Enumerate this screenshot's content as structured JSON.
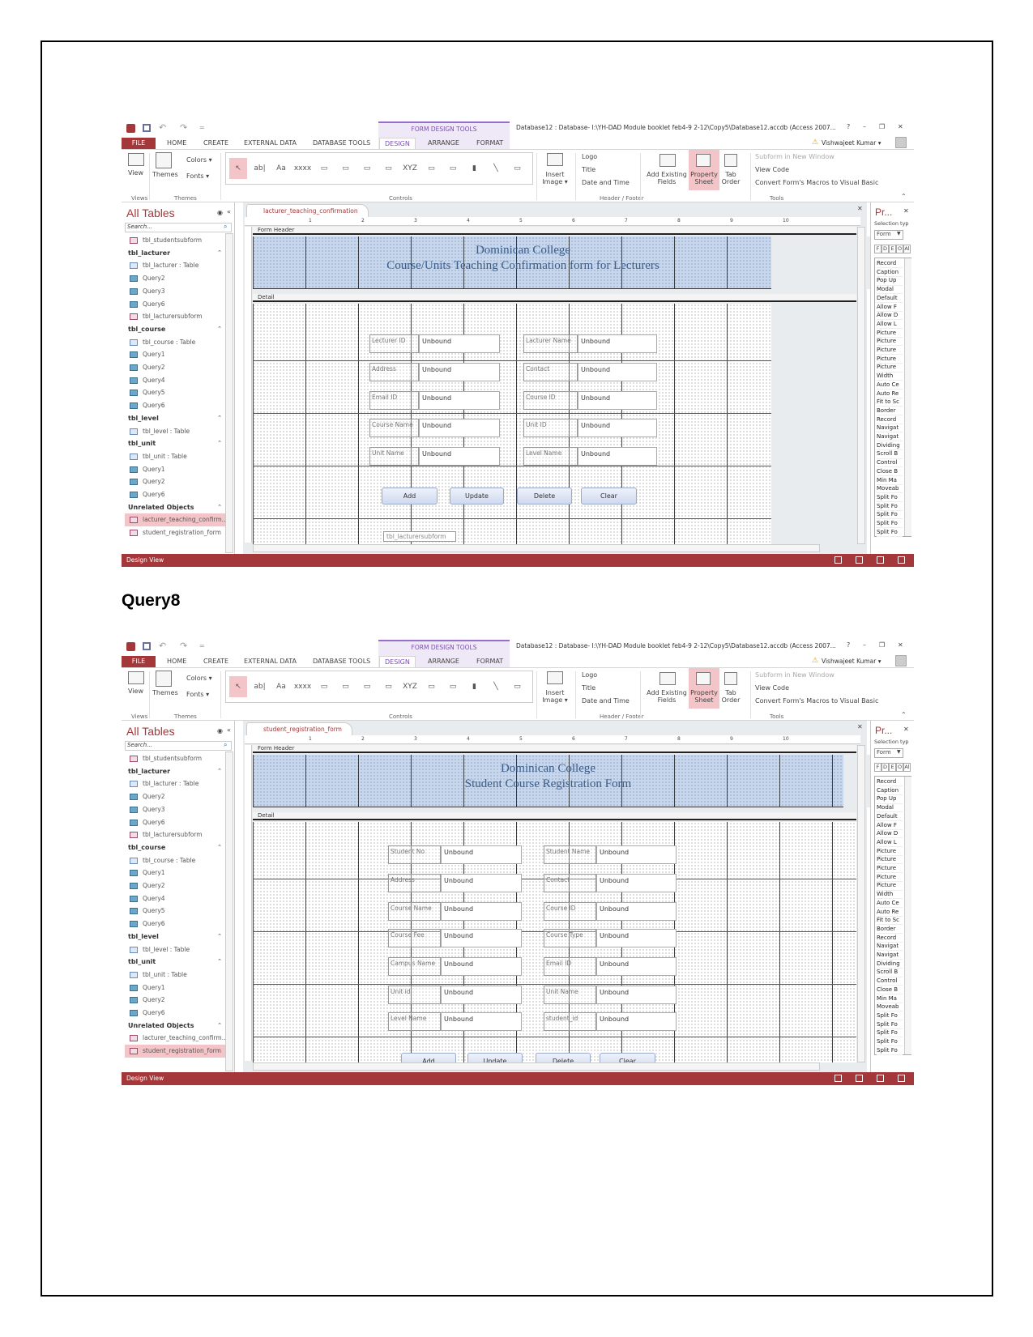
{
  "document": {
    "heading": "Query8"
  },
  "qat": {
    "app_icon": "access-logo-icon",
    "save": "save-icon",
    "undo": "undo-icon",
    "redo": "redo-icon",
    "customize": "="
  },
  "window": {
    "context_tab_group": "FORM DESIGN TOOLS",
    "title": "Database12 : Database- I:\\YH-DAD Module booklet feb4-9 2-12\\Copy5\\Database12.accdb (Access 2007...",
    "help": "?",
    "minimize": "–",
    "restore": "❐",
    "close": "✕",
    "user": "Vishwajeet Kumar ▾"
  },
  "ribbon_tabs": [
    "FILE",
    "HOME",
    "CREATE",
    "EXTERNAL DATA",
    "DATABASE TOOLS",
    "DESIGN",
    "ARRANGE",
    "FORMAT"
  ],
  "ribbon_selected_tab": "DESIGN",
  "ribbon": {
    "view": "View",
    "themes": "Themes",
    "colors": "Colors ▾",
    "fonts": "Fonts ▾",
    "insert_image": "Insert Image ▾",
    "logo": "Logo",
    "title": "Title",
    "date_time": "Date and Time",
    "add_existing_fields": "Add Existing Fields",
    "property_sheet": "Property Sheet",
    "tab_order": "Tab Order",
    "subform_new_window": "Subform in New Window",
    "view_code": "View Code",
    "convert_macros": "Convert Form's Macros to Visual Basic",
    "groups": [
      "Views",
      "Themes",
      "Controls",
      "Header / Footer",
      "Tools"
    ],
    "controls": [
      "select",
      "ab|",
      "Aa",
      "xxxx",
      "tab",
      "hyperlink",
      "web",
      "nav",
      "XYZ",
      "page-break",
      "combo",
      "chart",
      "line",
      "toggle"
    ]
  },
  "nav": {
    "title": "All Tables",
    "search_placeholder": "Search...",
    "items": [
      {
        "label": "tbl_studentsubform",
        "type": "form"
      },
      {
        "label": "tbl_lacturer",
        "type": "group"
      },
      {
        "label": "tbl_lacturer : Table",
        "type": "table"
      },
      {
        "label": "Query2",
        "type": "query"
      },
      {
        "label": "Query3",
        "type": "query"
      },
      {
        "label": "Query6",
        "type": "query"
      },
      {
        "label": "tbl_lacturersubform",
        "type": "form"
      },
      {
        "label": "tbl_course",
        "type": "group"
      },
      {
        "label": "tbl_course : Table",
        "type": "table"
      },
      {
        "label": "Query1",
        "type": "query"
      },
      {
        "label": "Query2",
        "type": "query"
      },
      {
        "label": "Query4",
        "type": "query"
      },
      {
        "label": "Query5",
        "type": "query"
      },
      {
        "label": "Query6",
        "type": "query"
      },
      {
        "label": "tbl_level",
        "type": "group"
      },
      {
        "label": "tbl_level : Table",
        "type": "table"
      },
      {
        "label": "tbl_unit",
        "type": "group"
      },
      {
        "label": "tbl_unit : Table",
        "type": "table"
      },
      {
        "label": "Query1",
        "type": "query"
      },
      {
        "label": "Query2",
        "type": "query"
      },
      {
        "label": "Query6",
        "type": "query"
      },
      {
        "label": "Unrelated Objects",
        "type": "group"
      },
      {
        "label": "lacturer_teaching_confirm...",
        "type": "form"
      },
      {
        "label": "student_registration_form",
        "type": "form"
      }
    ]
  },
  "ruler_numbers": [
    "1",
    "2",
    "3",
    "4",
    "5",
    "6",
    "7",
    "8",
    "9",
    "10"
  ],
  "sections": {
    "header": "Form Header",
    "detail": "Detail"
  },
  "property_sheet": {
    "title": "Pr...",
    "selection_type": "Selection typ",
    "selection_value": "Form",
    "tabs": [
      "F",
      "D",
      "E",
      "O",
      "Al"
    ],
    "items": [
      "Record",
      "Caption",
      "Pop Up",
      "Modal",
      "Default",
      "Allow F",
      "Allow D",
      "Allow L",
      "Picture",
      "Picture",
      "Picture",
      "Picture",
      "Picture",
      "Width",
      "Auto Ce",
      "Auto Re",
      "Fit to Sc",
      "Border",
      "Record",
      "Navigat",
      "Navigat",
      "Dividing",
      "Scroll B",
      "Control",
      "Close B",
      "Min Ma",
      "Moveab",
      "Split Fo",
      "Split Fo",
      "Split Fo",
      "Split Fo",
      "Split Fo"
    ]
  },
  "status": {
    "label": "Design View"
  },
  "colors": {
    "access_red": "#a4373a",
    "selected_item": "#f4c5c8",
    "header_band": "#c6d7ee",
    "header_text": "#3a5c8a"
  },
  "screens": [
    {
      "tab_label": "lacturer_teaching_confirmation",
      "nav_selected": 22,
      "header_lines": [
        "Dominican College",
        "Course/Units Teaching Confirmation form for Lecturers"
      ],
      "fields": [
        {
          "label": "Lecturer ID",
          "value": "Unbound"
        },
        {
          "label": "Lacturer Name",
          "value": "Unbound"
        },
        {
          "label": "Address",
          "value": "Unbound"
        },
        {
          "label": "Contact",
          "value": "Unbound"
        },
        {
          "label": "Email ID",
          "value": "Unbound"
        },
        {
          "label": "Course ID",
          "value": "Unbound"
        },
        {
          "label": "Course Name",
          "value": "Unbound"
        },
        {
          "label": "Unit ID",
          "value": "Unbound"
        },
        {
          "label": "Unit Name",
          "value": "Unbound"
        },
        {
          "label": "Level Name",
          "value": "Unbound"
        }
      ],
      "buttons": [
        "Add",
        "Update",
        "Delete",
        "Clear"
      ],
      "subform": "tbl_lacturersubform"
    },
    {
      "tab_label": "student_registration_form",
      "nav_selected": 23,
      "header_lines": [
        "Dominican College",
        "Student Course Registration Form"
      ],
      "fields": [
        {
          "label": "Student No",
          "value": "Unbound"
        },
        {
          "label": "Student Name",
          "value": "Unbound"
        },
        {
          "label": "Address",
          "value": "Unbound"
        },
        {
          "label": "Contact",
          "value": "Unbound"
        },
        {
          "label": "Course Name",
          "value": "Unbound"
        },
        {
          "label": "Course ID",
          "value": "Unbound"
        },
        {
          "label": "Course Fee",
          "value": "Unbound"
        },
        {
          "label": "Course Type",
          "value": "Unbound"
        },
        {
          "label": "Campus Name",
          "value": "Unbound"
        },
        {
          "label": "Email ID",
          "value": "Unbound"
        },
        {
          "label": "Unit id",
          "value": "Unbound"
        },
        {
          "label": "Unit Name",
          "value": "Unbound"
        },
        {
          "label": "Level Name",
          "value": "Unbound"
        },
        {
          "label": "student_id",
          "value": "Unbound"
        }
      ],
      "buttons": [
        "Add",
        "Update",
        "Delete",
        "Clear"
      ]
    }
  ]
}
